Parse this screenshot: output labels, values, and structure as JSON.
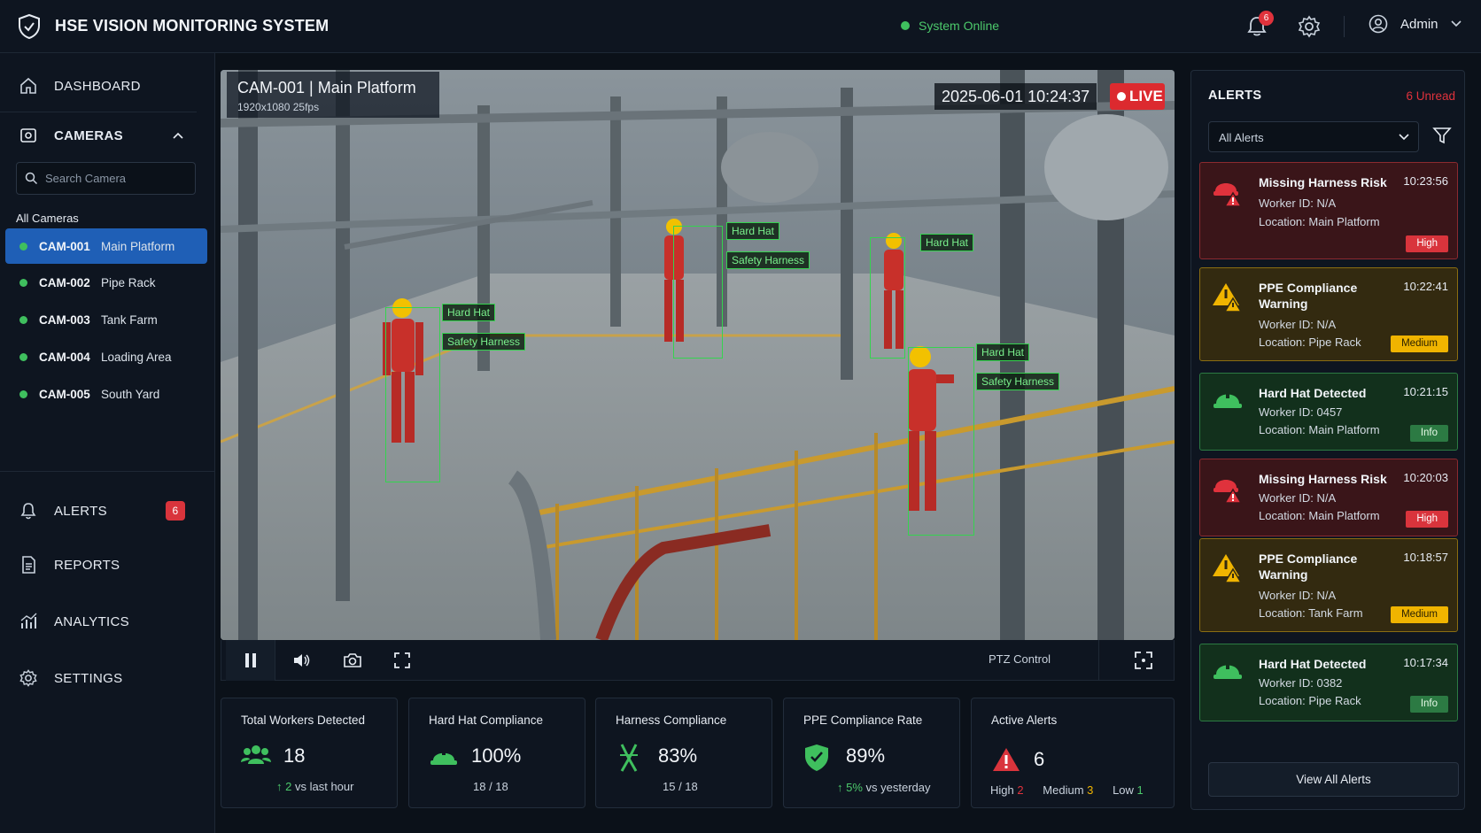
{
  "app": {
    "title": "HSE VISION MONITORING SYSTEM",
    "status": "System Online",
    "notifications": "6",
    "user": "Admin"
  },
  "sidebar": {
    "dashboard": "DASHBOARD",
    "cameras": "CAMERAS",
    "search_placeholder": "Search Camera",
    "all_cameras": "All Cameras",
    "camera_list": [
      {
        "id": "CAM-001",
        "name": "Main Platform"
      },
      {
        "id": "CAM-002",
        "name": "Pipe Rack"
      },
      {
        "id": "CAM-003",
        "name": "Tank Farm"
      },
      {
        "id": "CAM-004",
        "name": "Loading Area"
      },
      {
        "id": "CAM-005",
        "name": "South Yard"
      }
    ],
    "alerts": "ALERTS",
    "alerts_count": "6",
    "reports": "REPORTS",
    "analytics": "ANALYTICS",
    "settings": "SETTINGS"
  },
  "video": {
    "title": "CAM-001 | Main Platform",
    "spec": "1920x1080  25fps",
    "timestamp": "2025-06-01 10:24:37",
    "live": "LIVE",
    "labels": {
      "hard_hat": "Hard Hat",
      "harness": "Safety Harness"
    },
    "ptz": "PTZ Control"
  },
  "stats": {
    "workers": {
      "title": "Total Workers Detected",
      "value": "18",
      "delta": "2",
      "delta_text": "vs last hour"
    },
    "hardhat": {
      "title": "Hard Hat Compliance",
      "value": "100%",
      "ratio": "18 / 18"
    },
    "harness": {
      "title": "Harness Compliance",
      "value": "83%",
      "ratio": "15 / 18"
    },
    "ppe": {
      "title": "PPE Compliance Rate",
      "value": "89%",
      "delta": "5%",
      "delta_text": "vs yesterday"
    },
    "active": {
      "title": "Active Alerts",
      "value": "6",
      "high_label": "High",
      "high": "2",
      "medium_label": "Medium",
      "medium": "3",
      "low_label": "Low",
      "low": "1"
    }
  },
  "alerts_panel": {
    "title": "ALERTS",
    "unread": "6 Unread",
    "filter_value": "All Alerts",
    "view_all": "View All Alerts",
    "items": [
      {
        "title": "Missing Harness Risk",
        "time": "10:23:56",
        "worker": "Worker ID: N/A",
        "location": "Location: Main Platform",
        "level": "High"
      },
      {
        "title": "PPE Compliance Warning",
        "time": "10:22:41",
        "worker": "Worker ID: N/A",
        "location": "Location: Pipe Rack",
        "level": "Medium"
      },
      {
        "title": "Hard Hat Detected",
        "time": "10:21:15",
        "worker": "Worker ID: 0457",
        "location": "Location: Main Platform",
        "level": "Info"
      },
      {
        "title": "Missing Harness Risk",
        "time": "10:20:03",
        "worker": "Worker ID: N/A",
        "location": "Location: Main Platform",
        "level": "High"
      },
      {
        "title": "PPE Compliance Warning",
        "time": "10:18:57",
        "worker": "Worker ID: N/A",
        "location": "Location: Tank Farm",
        "level": "Medium"
      },
      {
        "title": "Hard Hat Detected",
        "time": "10:17:34",
        "worker": "Worker ID: 0382",
        "location": "Location: Pipe Rack",
        "level": "Info"
      }
    ]
  },
  "colors": {
    "accent": "#1f5fb6",
    "online": "#3fbf5e",
    "high": "#d9343c",
    "medium": "#f0b400",
    "info": "#2c7a43",
    "detection": "#35d34f"
  }
}
